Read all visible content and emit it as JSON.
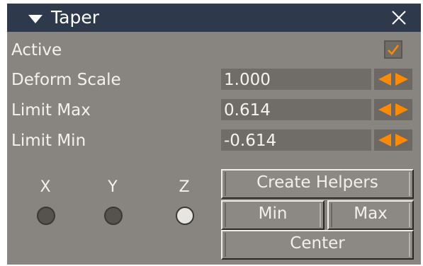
{
  "panel": {
    "title": "Taper",
    "close_glyph": "×",
    "collapse_icon": "triangle-down",
    "colors": {
      "titlebar": "#2e3a4c",
      "panel": "#888580",
      "accent": "#ff8a00"
    }
  },
  "active": {
    "label": "Active",
    "checked": true
  },
  "params": [
    {
      "label": "Deform Scale",
      "value": "1.000"
    },
    {
      "label": "Limit Max",
      "value": "0.614"
    },
    {
      "label": "Limit Min",
      "value": "-0.614"
    }
  ],
  "axes": [
    {
      "label": "X",
      "selected": false
    },
    {
      "label": "Y",
      "selected": false
    },
    {
      "label": "Z",
      "selected": true
    }
  ],
  "buttons": {
    "create_helpers": "Create Helpers",
    "min": "Min",
    "max": "Max",
    "center": "Center"
  }
}
